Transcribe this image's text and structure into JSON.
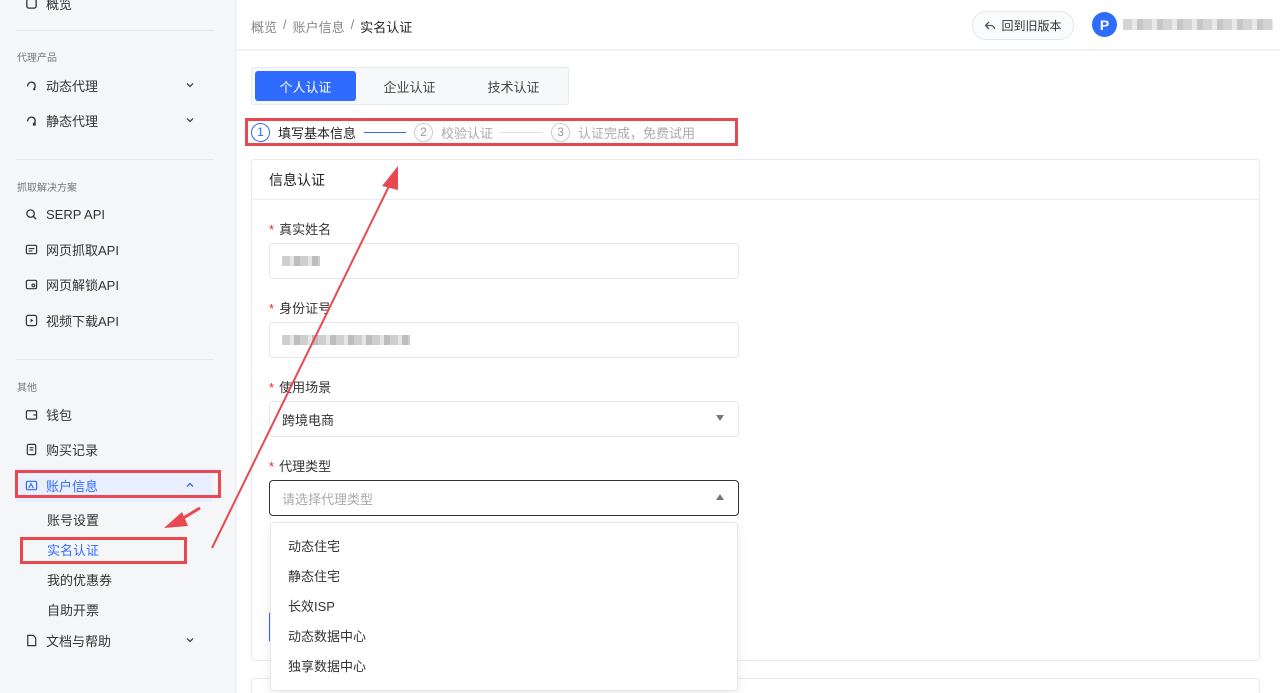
{
  "sidebar": {
    "top_item": "概览",
    "sections": [
      {
        "title": "代理产品",
        "items": [
          "动态代理",
          "静态代理"
        ]
      },
      {
        "title": "抓取解决方案",
        "items": [
          "SERP API",
          "网页抓取API",
          "网页解锁API",
          "视频下载API"
        ]
      },
      {
        "title": "其他",
        "items": [
          "钱包",
          "购买记录",
          "账户信息"
        ]
      }
    ],
    "account_subitems": [
      "账号设置",
      "实名认证",
      "我的优惠券",
      "自助开票"
    ],
    "docs_item": "文档与帮助"
  },
  "header": {
    "breadcrumb": [
      "概览",
      "账户信息",
      "实名认证"
    ],
    "separator": "/",
    "old_version_label": "回到旧版本",
    "avatar_letter": "P"
  },
  "tabs": [
    "个人认证",
    "企业认证",
    "技术认证"
  ],
  "steps": [
    {
      "num": "1",
      "label": "填写基本信息"
    },
    {
      "num": "2",
      "label": "校验认证"
    },
    {
      "num": "3",
      "label": "认证完成，免费试用"
    }
  ],
  "form": {
    "title": "信息认证",
    "required_mark": "*",
    "fields": {
      "name": {
        "label": "真实姓名"
      },
      "id_number": {
        "label": "身份证号"
      },
      "scenario": {
        "label": "使用场景",
        "value": "跨境电商"
      },
      "proxy_type": {
        "label": "代理类型",
        "placeholder": "请选择代理类型"
      }
    }
  },
  "dropdown_options": [
    "动态住宅",
    "静态住宅",
    "长效ISP",
    "动态数据中心",
    "独享数据中心"
  ],
  "colors": {
    "accent": "#2f6bff",
    "annotation": "#e8484f"
  }
}
